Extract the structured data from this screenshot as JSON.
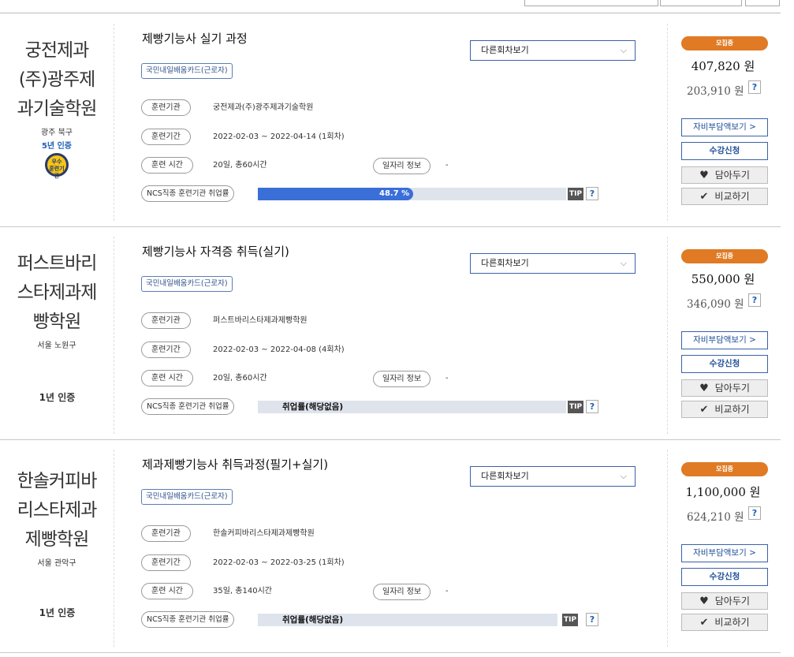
{
  "colors": {
    "accent": "#3a6fd8",
    "status": "#e07a24",
    "link": "#1f4e98"
  },
  "labels": {
    "round_select": "다른회차보기",
    "institution": "훈련기관",
    "period": "훈련기간",
    "hours": "훈련 시간",
    "job_info": "일자리 정보",
    "ncs": "NCS직종 훈련기관 취업률",
    "tip": "TIP",
    "self_pay": "자비부담액보기 >",
    "apply": "수강신청",
    "wishlist": "담아두기",
    "compare": "비교하기",
    "help": "?"
  },
  "courses": [
    {
      "institution_name": "궁전제과(주)광주제과기술학원",
      "institution_lines": [
        "궁전제과",
        "(주)광주제",
        "과기술학원"
      ],
      "region": "광주 북구",
      "cert_label": "5년 인증",
      "title": "제빵기능사 실기 과정",
      "card_tag": "국민내일배움카드(근로자)",
      "period": "2022-02-03 ~ 2022-04-14 (1회차)",
      "hours": "20일, 총60시간",
      "job_info": "-",
      "employment_rate": 48.7,
      "employment_text": "48.7 %",
      "status": "모집중",
      "price": "407,820 원",
      "sub_price": "203,910 원"
    },
    {
      "institution_name": "퍼스트바리스타제과제빵학원",
      "institution_lines": [
        "퍼스트바리",
        "스타제과제",
        "빵학원"
      ],
      "region": "서울 노원구",
      "cert_label": "1년 인증",
      "title": "제빵기능사 자격증 취득(실기)",
      "card_tag": "국민내일배움카드(근로자)",
      "period": "2022-02-03 ~ 2022-04-08 (4회차)",
      "hours": "20일, 총60시간",
      "job_info": "-",
      "employment_text": "취업률(해당없음)",
      "status": "모집중",
      "price": "550,000 원",
      "sub_price": "346,090 원"
    },
    {
      "institution_name": "한솔커피바리스타제과제빵학원",
      "institution_lines": [
        "한솔커피바",
        "리스타제과",
        "제빵학원"
      ],
      "region": "서울 관악구",
      "cert_label": "1년 인증",
      "title": "제과제빵기능사 취득과정(필기+실기)",
      "card_tag": "국민내일배움카드(근로자)",
      "period": "2022-02-03 ~ 2022-03-25 (1회차)",
      "hours": "35일, 총140시간",
      "job_info": "-",
      "employment_text": "취업률(해당없음)",
      "status": "모집중",
      "price": "1,100,000 원",
      "sub_price": "624,210 원"
    }
  ]
}
